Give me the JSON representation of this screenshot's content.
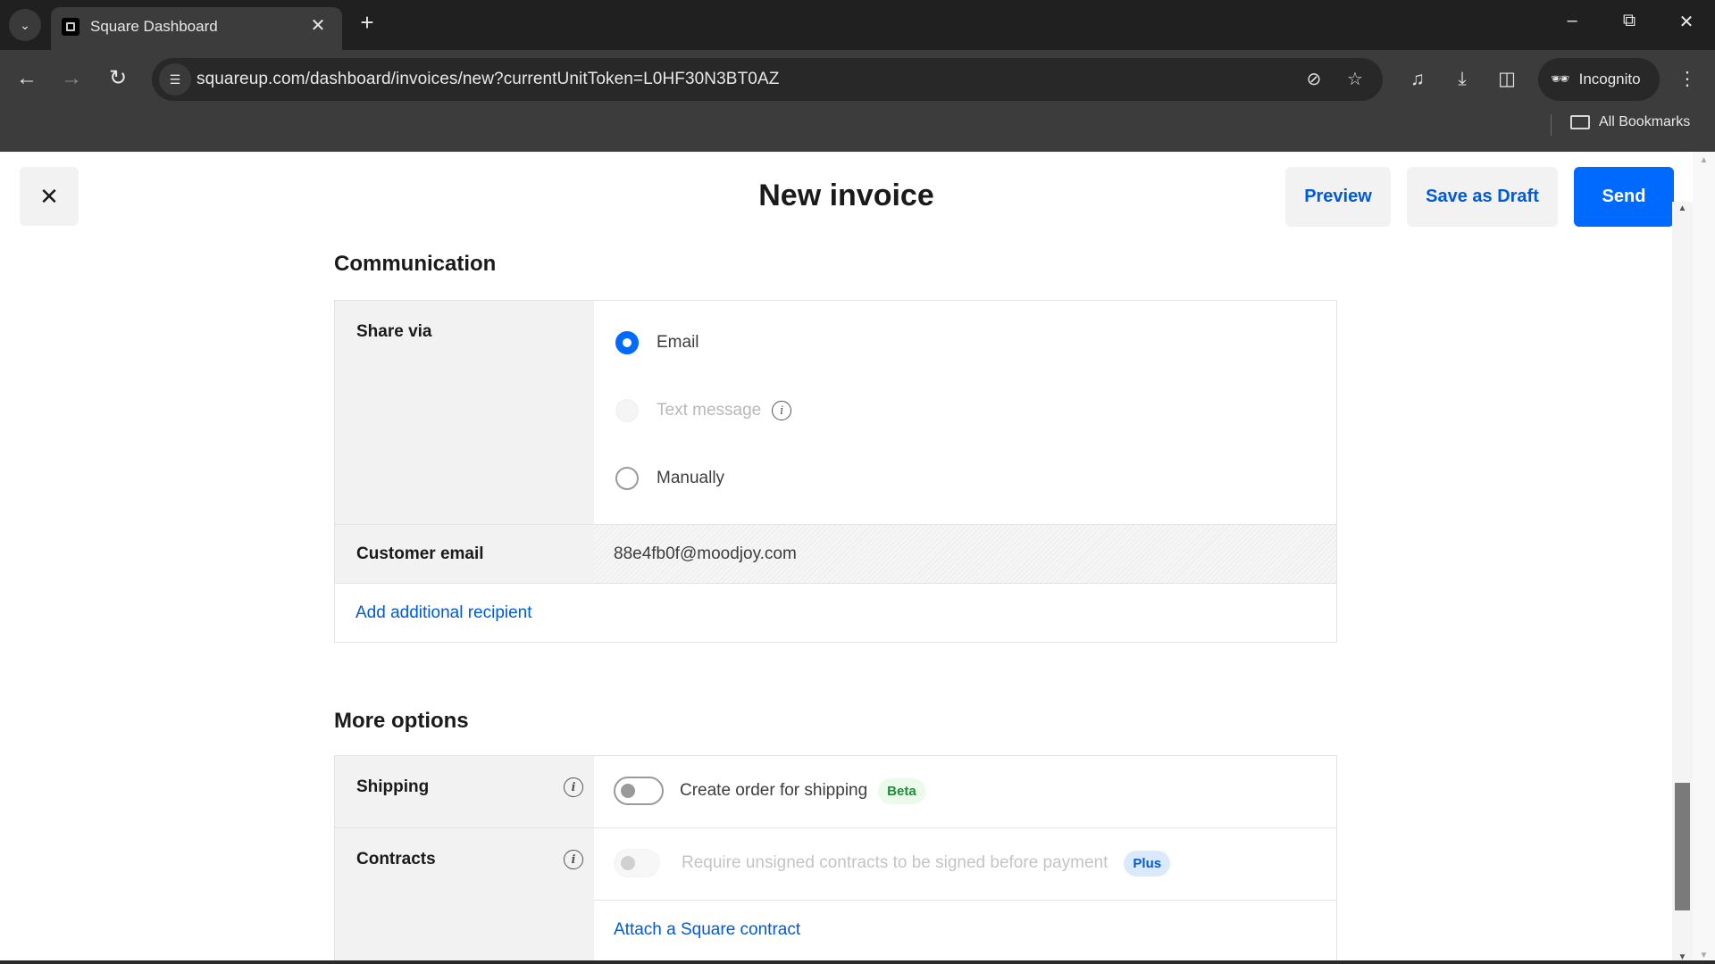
{
  "browser": {
    "tab_title": "Square Dashboard",
    "url": "squareup.com/dashboard/invoices/new?currentUnitToken=L0HF30N3BT0AZ",
    "incognito_label": "Incognito",
    "bookmarks_label": "All Bookmarks"
  },
  "header": {
    "title": "New invoice",
    "preview_label": "Preview",
    "save_draft_label": "Save as Draft",
    "send_label": "Send"
  },
  "communication": {
    "title": "Communication",
    "share_via_label": "Share via",
    "options": [
      {
        "label": "Email",
        "state": "selected"
      },
      {
        "label": "Text message",
        "state": "disabled"
      },
      {
        "label": "Manually",
        "state": "unselected"
      }
    ],
    "customer_email_label": "Customer email",
    "customer_email_value": "88e4fb0f@moodjoy.com",
    "add_recipient_label": "Add additional recipient"
  },
  "more_options": {
    "title": "More options",
    "shipping": {
      "label": "Shipping",
      "toggle_label": "Create order for shipping",
      "toggle_on": false,
      "badge": "Beta"
    },
    "contracts": {
      "label": "Contracts",
      "toggle_label": "Require unsigned contracts to be signed before payment",
      "toggle_on": false,
      "toggle_disabled": true,
      "badge": "Plus",
      "attach_label": "Attach a Square contract"
    }
  }
}
